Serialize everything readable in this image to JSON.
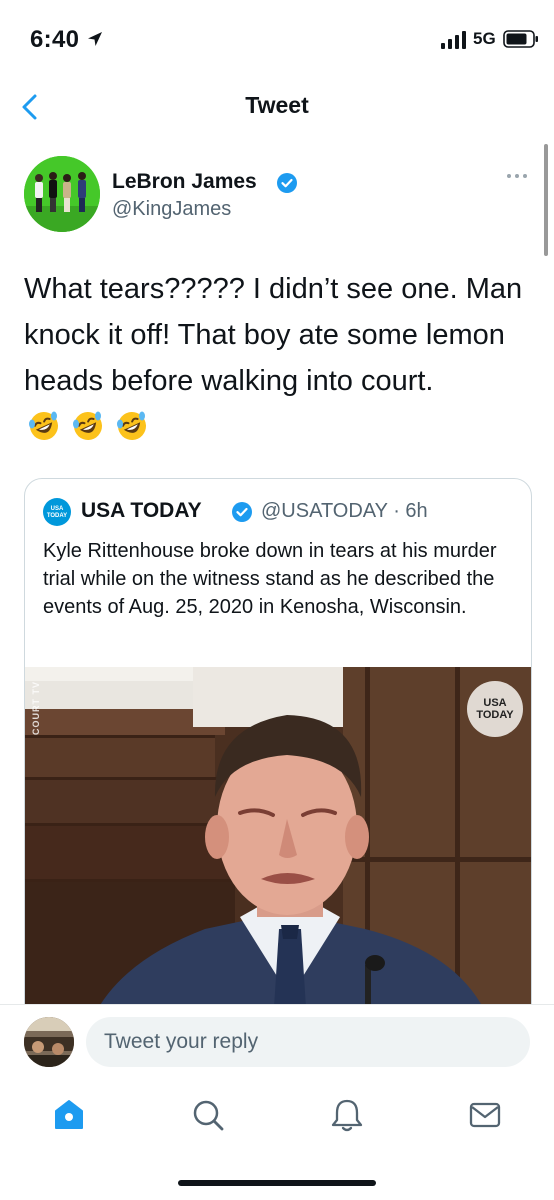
{
  "status_bar": {
    "time": "6:40",
    "network": "5G"
  },
  "nav": {
    "title": "Tweet"
  },
  "tweet": {
    "author_name": "LeBron James",
    "author_handle": "@KingJames",
    "text": "What tears????? I didn’t see one. Man knock it off! That boy ate some lemon heads before walking into court.",
    "emojis": [
      "rolling-on-floor-laughing-icon",
      "rolling-on-floor-laughing-icon",
      "rolling-on-floor-laughing-icon"
    ]
  },
  "quote": {
    "logo_text": "USA TODAY",
    "name": "USA TODAY",
    "handle_time": "@USATODAY · 6h",
    "text": "Kyle Rittenhouse broke down in tears at his murder trial while on the witness stand as he described the events of Aug. 25, 2020 in Kenosha, Wisconsin.",
    "media_watermark": "COURT TV",
    "media_badge": "USA TODAY"
  },
  "reply": {
    "placeholder": "Tweet your reply"
  },
  "tabs": [
    "home-icon",
    "search-icon",
    "notifications-icon",
    "messages-icon"
  ],
  "colors": {
    "accent": "#1d9bf0",
    "text": "#0f1419",
    "secondary": "#536471",
    "border": "#cfd9de"
  }
}
